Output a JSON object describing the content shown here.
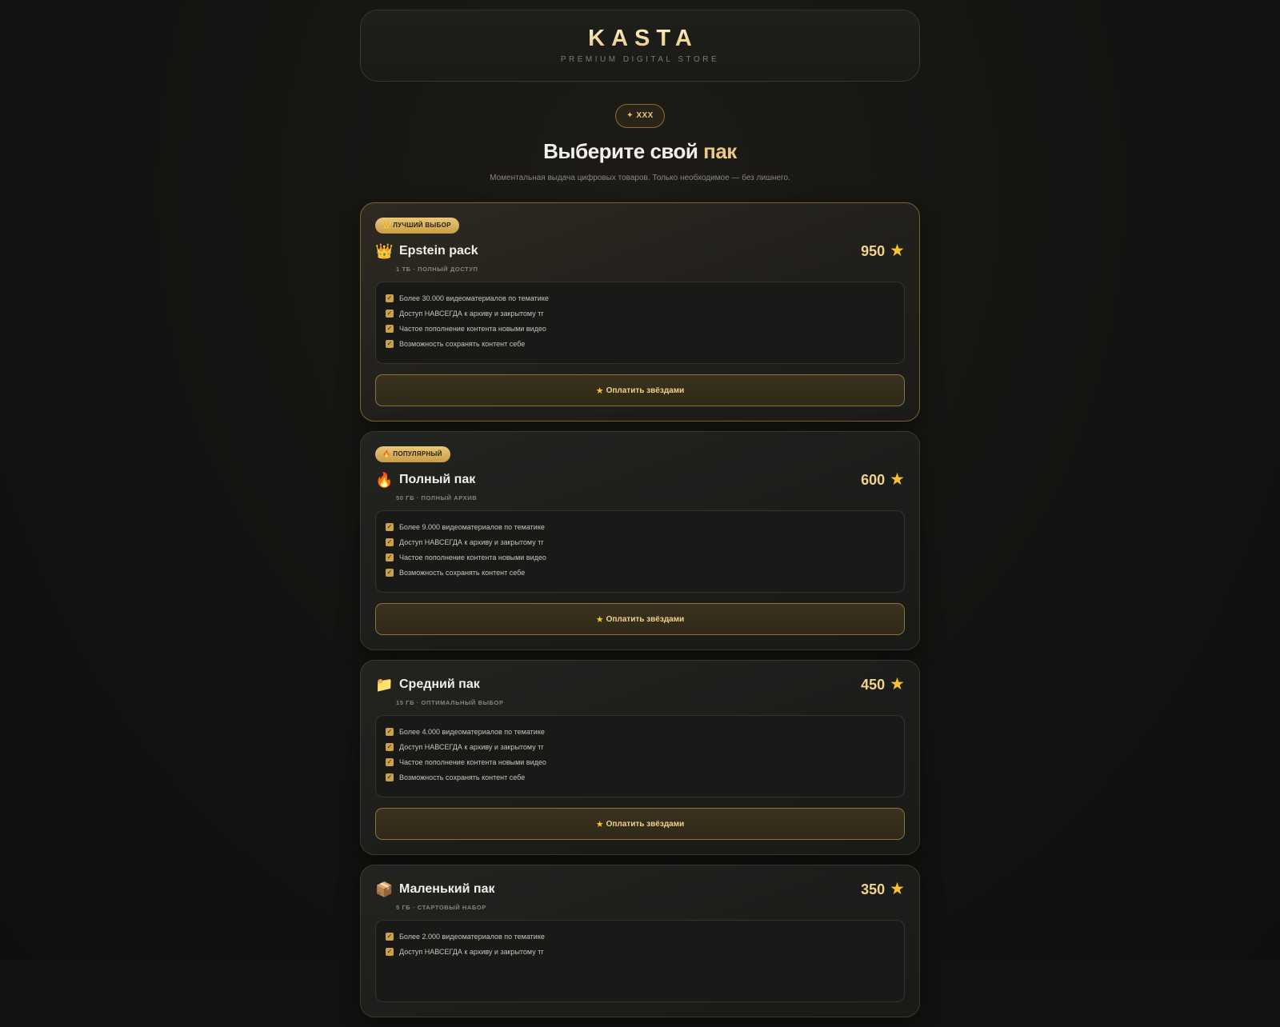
{
  "header": {
    "logo": "KASTA",
    "tagline": "PREMIUM DIGITAL STORE"
  },
  "hero": {
    "badge": "✦ XXX",
    "title_main": "Выберите свой",
    "title_accent": "пак",
    "subtitle": "Моментальная выдача цифровых товаров. Только необходимое — без лишнего."
  },
  "colors": {
    "accent": "#ecc97c",
    "star": "#f7c62c",
    "background": "#121210"
  },
  "cards": [
    {
      "pill": "ЛУЧШИЙ ВЫБОР",
      "pill_icon": "crown-icon",
      "emoji": "👑",
      "icon": "crown-icon",
      "title": "Epstein pack",
      "price": "950",
      "meta": "1 ТБ · ПОЛНЫЙ ДОСТУП",
      "features": [
        "Более 30.000 видеоматериалов по тематике",
        "Доступ НАВСЕГДА к архиву и закрытому тг",
        "Частое пополнение контента новыми видео",
        "Возможность сохранять контент себе"
      ],
      "button": "Оплатить звёздами"
    },
    {
      "pill": "ПОПУЛЯРНЫЙ",
      "pill_icon": "fire-icon",
      "emoji": "🔥",
      "icon": "fire-icon",
      "title": "Полный пак",
      "price": "600",
      "meta": "50 ГБ · ПОЛНЫЙ АРХИВ",
      "features": [
        "Более 9.000 видеоматериалов по тематике",
        "Доступ НАВСЕГДА к архиву и закрытому тг",
        "Частое пополнение контента новыми видео",
        "Возможность сохранять контент себе"
      ],
      "button": "Оплатить звёздами"
    },
    {
      "emoji": "📁",
      "icon": "folder-icon",
      "title": "Средний пак",
      "price": "450",
      "meta": "15 ГБ · ОПТИМАЛЬНЫЙ ВЫБОР",
      "features": [
        "Более 4.000 видеоматериалов по тематике",
        "Доступ НАВСЕГДА к архиву и закрытому тг",
        "Частое пополнение контента новыми видео",
        "Возможность сохранять контент себе"
      ],
      "button": "Оплатить звёздами"
    },
    {
      "emoji": "📦",
      "icon": "box-icon",
      "title": "Маленький пак",
      "price": "350",
      "meta": "5 ГБ · СТАРТОВЫЙ НАБОР",
      "features": [
        "Более 2.000 видеоматериалов по тематике",
        "Доступ НАВСЕГДА к архиву и закрытому тг"
      ]
    }
  ]
}
